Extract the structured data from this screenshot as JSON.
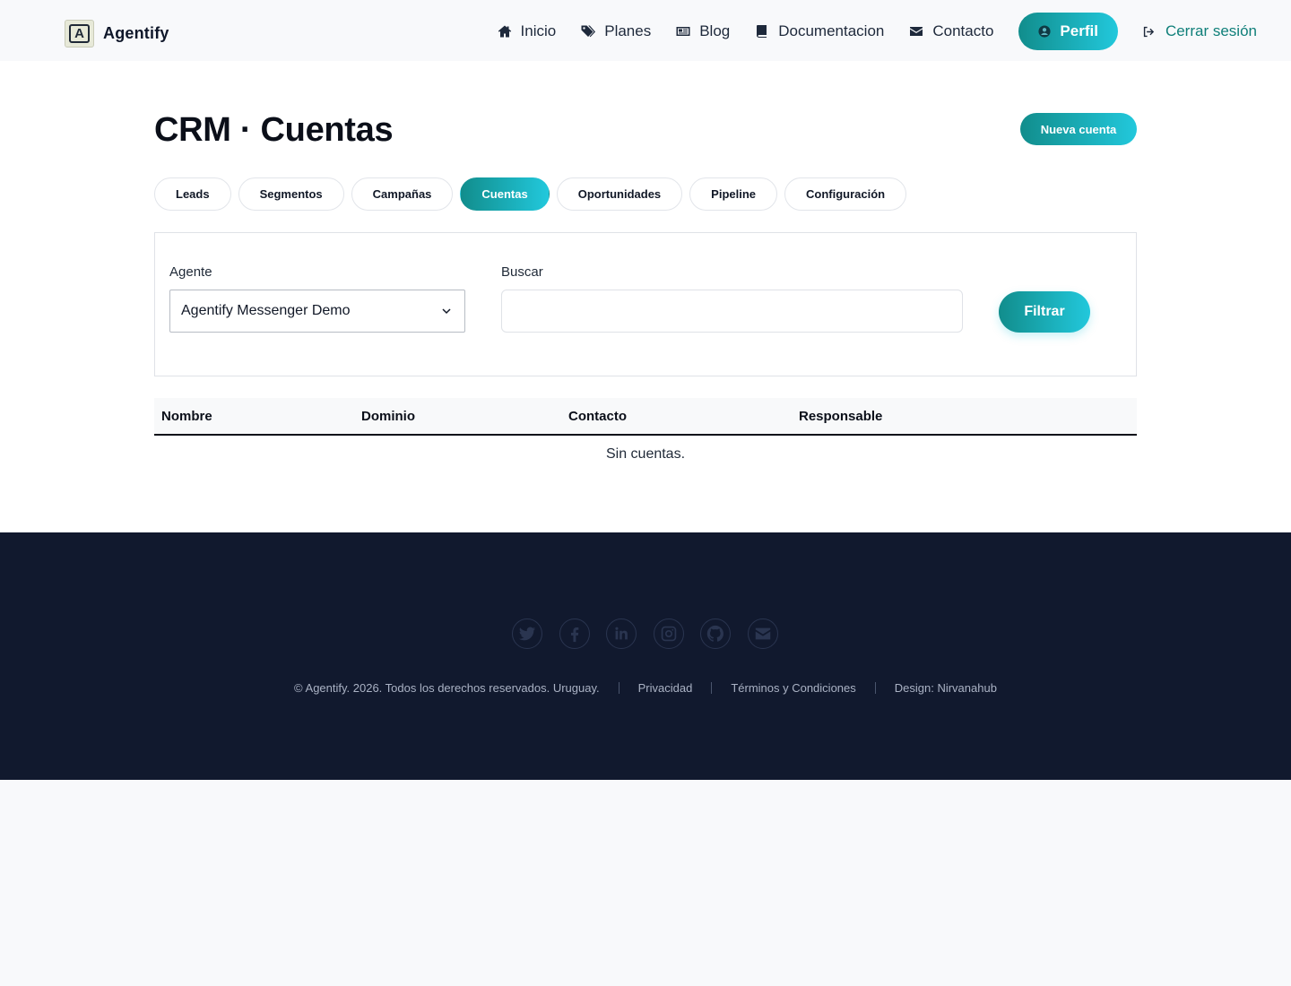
{
  "brand": {
    "name": "Agentify",
    "logo_letter": "A"
  },
  "nav": {
    "items": [
      {
        "label": "Inicio",
        "icon": "home-icon"
      },
      {
        "label": "Planes",
        "icon": "tags-icon"
      },
      {
        "label": "Blog",
        "icon": "newspaper-icon"
      },
      {
        "label": "Documentacion",
        "icon": "book-icon"
      },
      {
        "label": "Contacto",
        "icon": "envelope-icon"
      }
    ],
    "profile_label": "Perfil",
    "logout_label": "Cerrar sesión"
  },
  "page": {
    "title": "CRM · Cuentas",
    "new_button": "Nueva cuenta"
  },
  "tabs": [
    {
      "label": "Leads",
      "active": false
    },
    {
      "label": "Segmentos",
      "active": false
    },
    {
      "label": "Campañas",
      "active": false
    },
    {
      "label": "Cuentas",
      "active": true
    },
    {
      "label": "Oportunidades",
      "active": false
    },
    {
      "label": "Pipeline",
      "active": false
    },
    {
      "label": "Configuración",
      "active": false
    }
  ],
  "filters": {
    "agent_label": "Agente",
    "agent_value": "Agentify Messenger Demo",
    "search_label": "Buscar",
    "search_value": "",
    "filter_button": "Filtrar"
  },
  "table": {
    "columns": [
      "Nombre",
      "Dominio",
      "Contacto",
      "Responsable"
    ],
    "empty_message": "Sin cuentas."
  },
  "footer": {
    "socials": [
      "twitter-icon",
      "facebook-icon",
      "linkedin-icon",
      "instagram-icon",
      "github-icon",
      "email-icon"
    ],
    "copyright": "© Agentify. 2026. Todos los derechos reservados. Uruguay.",
    "privacy": "Privacidad",
    "terms": "Términos y Condiciones",
    "design": "Design: Nirvanahub"
  },
  "colors": {
    "accent_start": "#118d8c",
    "accent_end": "#22c8dc",
    "footer_bg": "#11192e",
    "logout_text": "#0f7f79"
  }
}
